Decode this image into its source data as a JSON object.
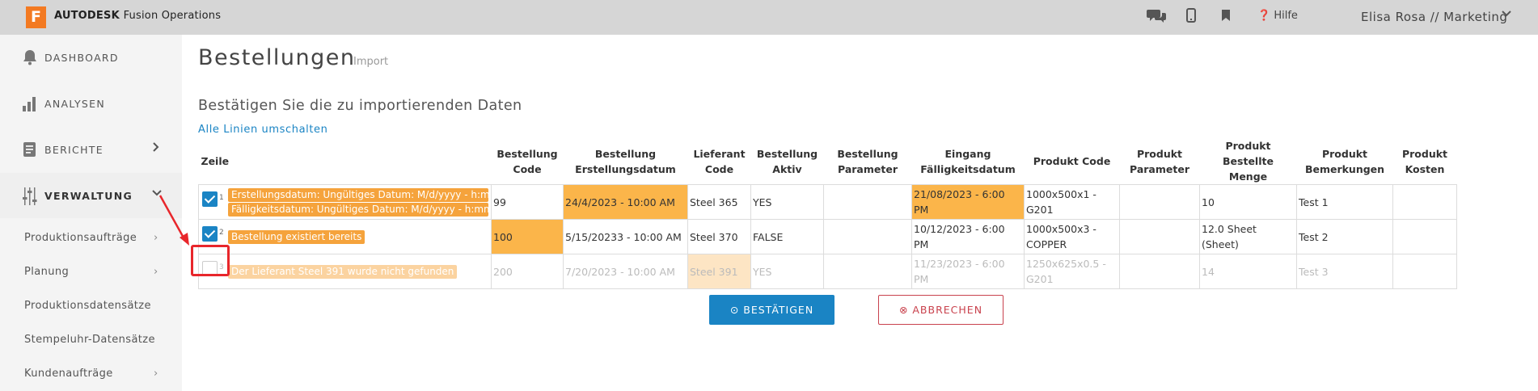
{
  "app": {
    "logo_letter": "F",
    "brand_bold": "AUTODESK",
    "brand_rest": "Fusion Operations",
    "help_label": "Hilfe",
    "user_label": "Elisa Rosa // Marketing"
  },
  "sidebar": {
    "main": [
      {
        "label": "DASHBOARD"
      },
      {
        "label": "ANALYSEN"
      },
      {
        "label": "BERICHTE"
      },
      {
        "label": "VERWALTUNG"
      }
    ],
    "sub": [
      {
        "label": "Produktionsaufträge"
      },
      {
        "label": "Planung"
      },
      {
        "label": "Produktionsdatensätze"
      },
      {
        "label": "Stempeluhr-Datensätze"
      },
      {
        "label": "Kundenaufträge"
      }
    ]
  },
  "page": {
    "title": "Bestellungen",
    "subtitle": "Import",
    "section_title": "Bestätigen Sie die zu importierenden Daten",
    "toggle_link": "Alle Linien umschalten"
  },
  "table": {
    "headers": {
      "zeile": "Zeile",
      "h1a": "Bestellung",
      "h1b": "Code",
      "h2a": "Bestellung",
      "h2b": "Erstellungsdatum",
      "h3a": "Lieferant",
      "h3b": "Code",
      "h4a": "Bestellung",
      "h4b": "Aktiv",
      "h5a": "Bestellung",
      "h5b": "Parameter",
      "h6a": "Eingang",
      "h6b": "Fälligkeitsdatum",
      "h7": "Produkt Code",
      "h8a": "Produkt",
      "h8b": "Parameter",
      "h9a": "Produkt Bestellte",
      "h9b": "Menge",
      "h10a": "Produkt",
      "h10b": "Bemerkungen",
      "h11a": "Produkt",
      "h11b": "Kosten"
    },
    "rows": [
      {
        "num": "1",
        "tag1": "Erstellungsdatum: Ungültiges Datum: M/d/yyyy - h:mm a",
        "tag2": "Fälligkeitsdatum: Ungültiges Datum: M/d/yyyy - h:mm a",
        "code": "99",
        "created": "24/4/2023 - 10:00 AM",
        "supplier": "Steel 365",
        "active": "YES",
        "params": "",
        "due": "21/08/2023 - 6:00 PM",
        "product_code": "1000x500x1 - G201",
        "product_params": "",
        "qty": "10",
        "remarks": "Test 1",
        "cost": ""
      },
      {
        "num": "2",
        "tag1": "Bestellung existiert bereits",
        "code": "100",
        "created": "5/15/20233 - 10:00 AM",
        "supplier": "Steel 370",
        "active": "FALSE",
        "params": "",
        "due": "10/12/2023 - 6:00 PM",
        "product_code": "1000x500x3 - COPPER",
        "product_params": "",
        "qty": "12.0 Sheet (Sheet)",
        "remarks": "Test 2",
        "cost": ""
      },
      {
        "num": "3",
        "tag1": "Der Lieferant Steel 391 wurde nicht gefunden",
        "code": "200",
        "created": "7/20/2023 - 10:00 AM",
        "supplier": "Steel 391",
        "active": "YES",
        "params": "",
        "due": "11/23/2023 - 6:00 PM",
        "product_code": "1250x625x0.5 - G201",
        "product_params": "",
        "qty": "14",
        "remarks": "Test 3",
        "cost": ""
      }
    ]
  },
  "buttons": {
    "confirm": "⊙ BESTÄTIGEN",
    "cancel": "⊗ ABBRECHEN"
  },
  "colors": {
    "accent": "#1a84c4",
    "warning": "#fbb54a",
    "danger": "#c9424d",
    "annotation": "#e8262b"
  }
}
